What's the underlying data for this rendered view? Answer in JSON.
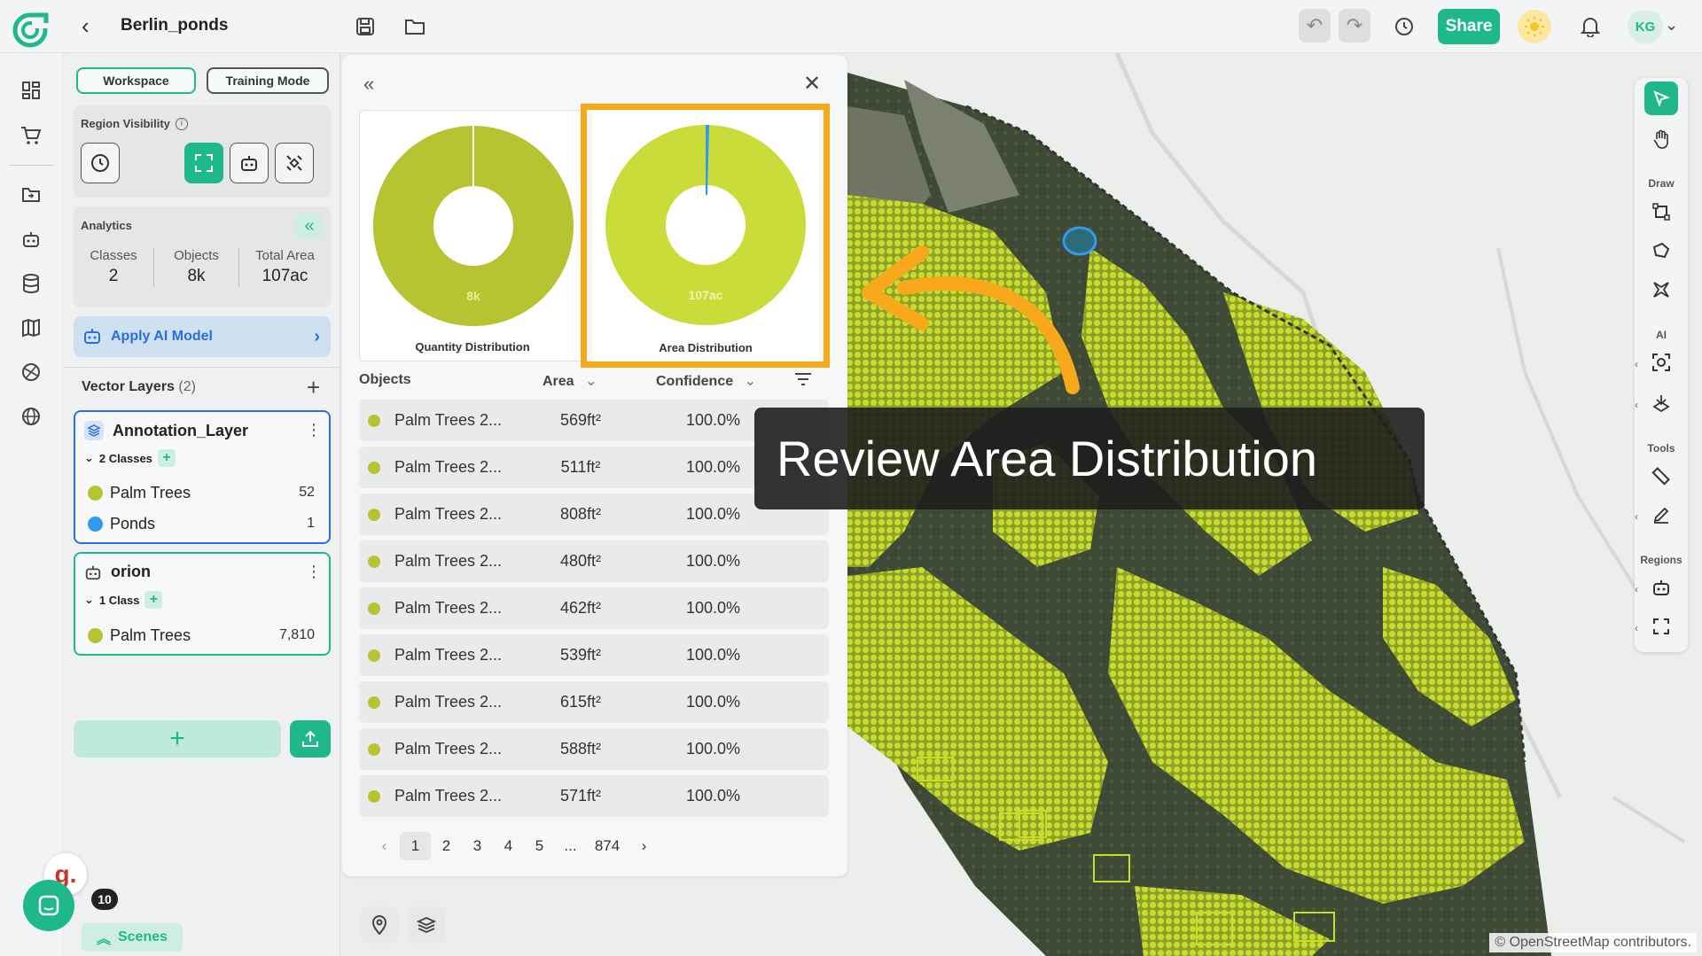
{
  "project": {
    "title": "Berlin_ponds"
  },
  "topbar": {
    "share_label": "Share",
    "user_initials": "KG"
  },
  "panel": {
    "workspace_label": "Workspace",
    "training_label": "Training Mode",
    "region_visibility_label": "Region Visibility",
    "analytics_label": "Analytics",
    "stats": [
      {
        "label": "Classes",
        "value": "2"
      },
      {
        "label": "Objects",
        "value": "8k"
      },
      {
        "label": "Total Area",
        "value": "107ac"
      }
    ],
    "apply_ai_label": "Apply AI Model",
    "vector_layers_label": "Vector Layers",
    "vector_layers_count": "(2)",
    "layers": [
      {
        "name": "Annotation_Layer",
        "classes_label": "2 Classes",
        "classes": [
          {
            "name": "Palm Trees",
            "count": "52",
            "color": "#b6c432"
          },
          {
            "name": "Ponds",
            "count": "1",
            "color": "#2d9bf0"
          }
        ]
      },
      {
        "name": "orion",
        "classes_label": "1 Class",
        "classes": [
          {
            "name": "Palm Trees",
            "count": "7,810",
            "color": "#b6c432"
          }
        ]
      }
    ]
  },
  "analytics": {
    "charts": [
      {
        "caption": "Quantity Distribution",
        "center_label": "8k",
        "color": "#b6c432"
      },
      {
        "caption": "Area Distribution",
        "center_label": "107ac",
        "color": "#c9dc3a"
      }
    ],
    "columns": {
      "objects": "Objects",
      "area": "Area",
      "confidence": "Confidence"
    },
    "rows": [
      {
        "name": "Palm Trees 2...",
        "area": "569ft²",
        "confidence": "100.0%"
      },
      {
        "name": "Palm Trees 2...",
        "area": "511ft²",
        "confidence": "100.0%"
      },
      {
        "name": "Palm Trees 2...",
        "area": "808ft²",
        "confidence": "100.0%"
      },
      {
        "name": "Palm Trees 2...",
        "area": "480ft²",
        "confidence": "100.0%"
      },
      {
        "name": "Palm Trees 2...",
        "area": "462ft²",
        "confidence": "100.0%"
      },
      {
        "name": "Palm Trees 2...",
        "area": "539ft²",
        "confidence": "100.0%"
      },
      {
        "name": "Palm Trees 2...",
        "area": "615ft²",
        "confidence": "100.0%"
      },
      {
        "name": "Palm Trees 2...",
        "area": "588ft²",
        "confidence": "100.0%"
      },
      {
        "name": "Palm Trees 2...",
        "area": "571ft²",
        "confidence": "100.0%"
      }
    ],
    "pages": [
      "1",
      "2",
      "3",
      "4",
      "5",
      "...",
      "874"
    ],
    "current_page": "1"
  },
  "right_tools": {
    "draw_label": "Draw",
    "ai_label": "AI",
    "tools_label": "Tools",
    "regions_label": "Regions"
  },
  "bottom": {
    "scenes_label": "Scenes",
    "notification_count": "10",
    "helper_letter": "g."
  },
  "map": {
    "credit": "© OpenStreetMap contributors."
  },
  "callout": {
    "text": "Review Area Distribution"
  },
  "colors": {
    "accent": "#1fb88a",
    "highlight": "#f7a81b",
    "palm": "#b6c432",
    "pond": "#2d9bf0",
    "link": "#2a6fdb"
  }
}
